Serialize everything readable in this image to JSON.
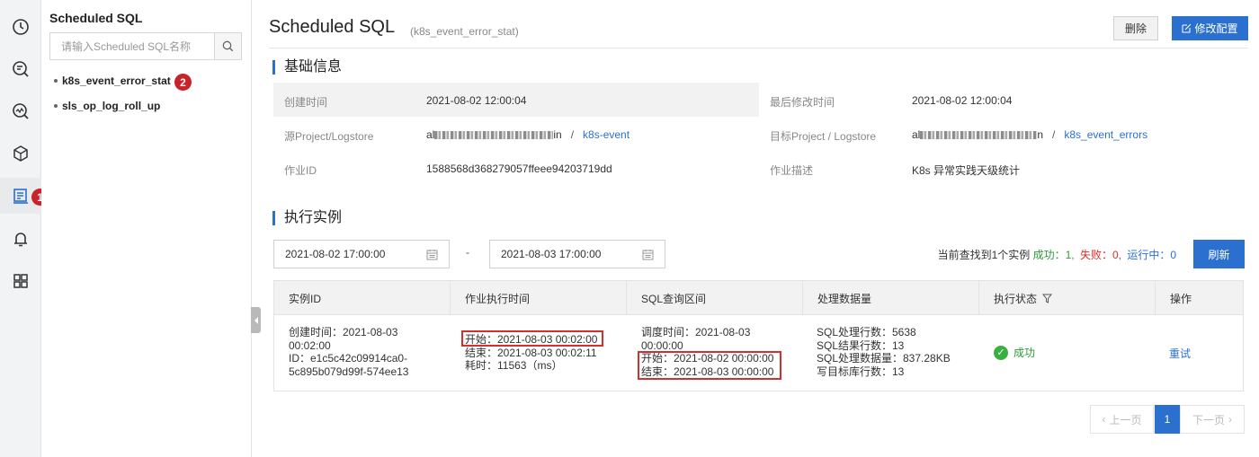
{
  "sidebar": {
    "title": "Scheduled SQL",
    "search_placeholder": "请输入Scheduled SQL名称",
    "items": [
      {
        "label": "k8s_event_error_stat"
      },
      {
        "label": "sls_op_log_roll_up"
      }
    ]
  },
  "markers": {
    "one": "1",
    "two": "2"
  },
  "header": {
    "title": "Scheduled SQL",
    "subtitle": "(k8s_event_error_stat)",
    "delete_label": "删除",
    "edit_label": "修改配置"
  },
  "basic_info": {
    "section_title": "基础信息",
    "created_label": "创建时间",
    "created_value": "2021-08-02 12:00:04",
    "modified_label": "最后修改时间",
    "modified_value": "2021-08-02 12:00:04",
    "source_label": "源Project/Logstore",
    "source_project_prefix": "al",
    "source_project_suffix": "in",
    "source_logstore": "k8s-event",
    "target_label": "目标Project / Logstore",
    "target_project_prefix": "al",
    "target_project_suffix": "n",
    "target_logstore": "k8s_event_errors",
    "job_id_label": "作业ID",
    "job_id_value": "1588568d368279057ffeee94203719dd",
    "job_desc_label": "作业描述",
    "job_desc_value": "K8s 异常实践天级统计"
  },
  "instances": {
    "section_title": "执行实例",
    "start_date": "2021-08-02 17:00:00",
    "end_date": "2021-08-03 17:00:00",
    "range_sep": "-",
    "summary_prefix": "当前查找到1个实例",
    "summary_success": "成功：1,",
    "summary_failed": "失败：0,",
    "summary_running": "运行中：0",
    "refresh_label": "刷新",
    "colors": {
      "success": "#2e9b37",
      "failed": "#d0312d",
      "running": "#2b70cf"
    }
  },
  "table": {
    "headers": [
      "实例ID",
      "作业执行时间",
      "SQL查询区间",
      "处理数据量",
      "执行状态",
      "操作"
    ],
    "row": {
      "instance_lines": [
        "创建时间：2021-08-03",
        "00:02:00",
        "ID：e1c5c42c09914ca0-",
        "5c895b079d99f-574ee13"
      ],
      "exec_lines": [
        "开始：2021-08-03 00:02:00",
        "结束：2021-08-03 00:02:11",
        "耗时：11563（ms）"
      ],
      "sql_lines": [
        "调度时间：2021-08-03",
        "00:00:00",
        "开始：2021-08-02 00:00:00",
        "结束：2021-08-03 00:00:00"
      ],
      "data_lines": [
        "SQL处理行数：5638",
        "SQL结果行数：13",
        "SQL处理数据量：837.28KB",
        "写目标库行数：13"
      ],
      "status": "成功",
      "action": "重试"
    }
  },
  "pager": {
    "prev": "上一页",
    "current": "1",
    "next": "下一页"
  }
}
